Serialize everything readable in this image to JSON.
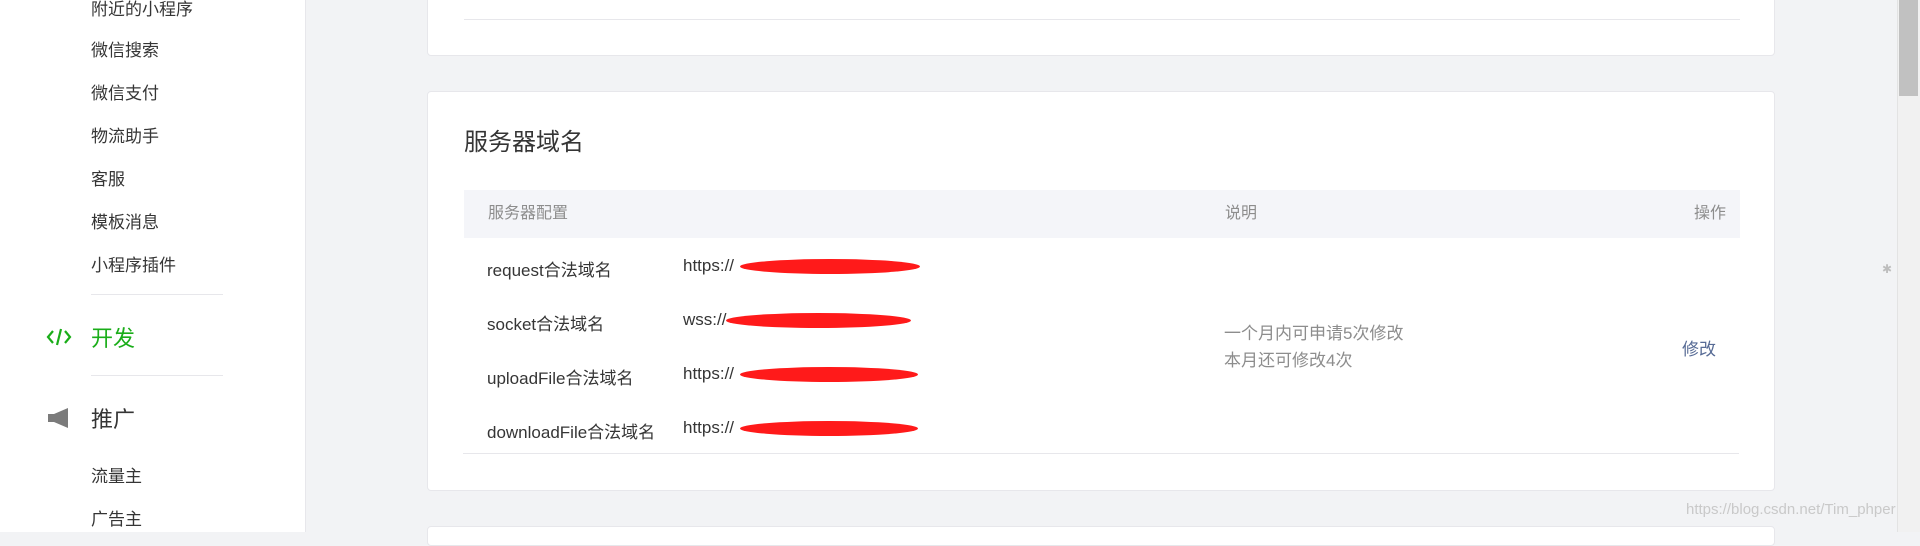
{
  "sidebar": {
    "items_top": [
      "附近的小程序",
      "微信搜索",
      "微信支付",
      "物流助手",
      "客服",
      "模板消息",
      "小程序插件"
    ],
    "dev_section": {
      "label": "开发",
      "icon": "code-icon",
      "color": "#1aad19"
    },
    "promo_section": {
      "label": "推广",
      "icon": "megaphone-icon"
    },
    "items_bottom": [
      "流量主",
      "广告主"
    ]
  },
  "server_domain": {
    "title": "服务器域名",
    "columns": {
      "config": "服务器配置",
      "description": "说明",
      "action": "操作"
    },
    "rows": [
      {
        "label": "request合法域名",
        "url_prefix": "https://"
      },
      {
        "label": "socket合法域名",
        "url_prefix": "wss://"
      },
      {
        "label": "uploadFile合法域名",
        "url_prefix": "https://"
      },
      {
        "label": "downloadFile合法域名",
        "url_prefix": "https://"
      }
    ],
    "description_lines": [
      "一个月内可申请5次修改",
      "本月还可修改4次"
    ],
    "modify_label": "修改"
  },
  "watermark": "https://blog.csdn.net/Tim_phper"
}
